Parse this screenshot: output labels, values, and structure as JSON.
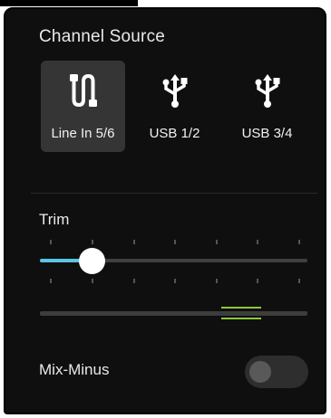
{
  "channel_source": {
    "title": "Channel Source",
    "options": [
      {
        "label": "Line In 5/6",
        "icon": "cable-icon",
        "selected": true
      },
      {
        "label": "USB 1/2",
        "icon": "usb-icon",
        "selected": false
      },
      {
        "label": "USB 3/4",
        "icon": "usb-icon",
        "selected": false
      }
    ]
  },
  "trim": {
    "title": "Trim",
    "value_fraction": 0.19,
    "tick_count": 7
  },
  "mix_minus": {
    "label": "Mix-Minus",
    "enabled": false
  },
  "colors": {
    "panel_bg": "#0f0f0f",
    "selected_bg": "#353535",
    "slider_accent": "#58c4e6",
    "meter_accent": "#8cc83a"
  }
}
